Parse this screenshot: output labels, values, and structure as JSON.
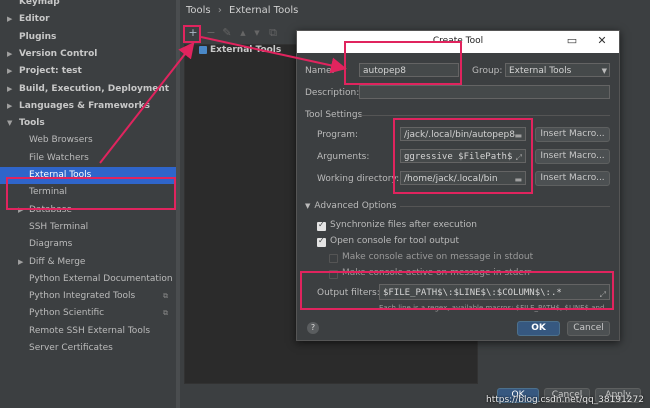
{
  "sidebar": {
    "items": [
      {
        "label": "Keymap",
        "arrow": "",
        "indent": 0,
        "bold": true
      },
      {
        "label": "Editor",
        "arrow": "▶",
        "indent": 0,
        "bold": true
      },
      {
        "label": "Plugins",
        "arrow": "",
        "indent": 0,
        "bold": true
      },
      {
        "label": "Version Control",
        "arrow": "▶",
        "indent": 0,
        "bold": true
      },
      {
        "label": "Project: test",
        "arrow": "▶",
        "indent": 0,
        "bold": true
      },
      {
        "label": "Build, Execution, Deployment",
        "arrow": "▶",
        "indent": 0,
        "bold": true
      },
      {
        "label": "Languages & Frameworks",
        "arrow": "▶",
        "indent": 0,
        "bold": true
      },
      {
        "label": "Tools",
        "arrow": "▼",
        "indent": 0,
        "bold": true
      },
      {
        "label": "Web Browsers",
        "arrow": "",
        "indent": 1,
        "bold": false
      },
      {
        "label": "File Watchers",
        "arrow": "",
        "indent": 1,
        "bold": false
      },
      {
        "label": "External Tools",
        "arrow": "",
        "indent": 1,
        "bold": false,
        "selected": true
      },
      {
        "label": "Terminal",
        "arrow": "",
        "indent": 1,
        "bold": false
      },
      {
        "label": "Database",
        "arrow": "▶",
        "indent": 1,
        "bold": false
      },
      {
        "label": "SSH Terminal",
        "arrow": "",
        "indent": 1,
        "bold": false
      },
      {
        "label": "Diagrams",
        "arrow": "",
        "indent": 1,
        "bold": false
      },
      {
        "label": "Diff & Merge",
        "arrow": "▶",
        "indent": 1,
        "bold": false
      },
      {
        "label": "Python External Documentation",
        "arrow": "",
        "indent": 1,
        "bold": false
      },
      {
        "label": "Python Integrated Tools",
        "arrow": "",
        "indent": 1,
        "bold": false,
        "badge": "⧉"
      },
      {
        "label": "Python Scientific",
        "arrow": "",
        "indent": 1,
        "bold": false,
        "badge": "⧉"
      },
      {
        "label": "Remote SSH External Tools",
        "arrow": "",
        "indent": 1,
        "bold": false
      },
      {
        "label": "Server Certificates",
        "arrow": "",
        "indent": 1,
        "bold": false
      }
    ]
  },
  "breadcrumb": {
    "part1": "Tools",
    "sep": "›",
    "part2": "External Tools"
  },
  "toolbar": {
    "add": "+",
    "remove": "−",
    "edit": "✎",
    "up": "▲",
    "down": "▼",
    "copy": "⧉"
  },
  "tree": {
    "group_label": "External Tools"
  },
  "dialog": {
    "title": "Create Tool",
    "name_label": "Name:",
    "name_value": "autopep8",
    "group_label": "Group:",
    "group_value": "External Tools",
    "description_label": "Description:",
    "description_value": "",
    "tool_settings": "Tool Settings",
    "program_label": "Program:",
    "program_value": "/jack/.local/bin/autopep8",
    "arguments_label": "Arguments:",
    "arguments_value": "ggressive $FilePath$",
    "workdir_label": "Working directory:",
    "workdir_value": "/home/jack/.local/bin",
    "insert_macro": "Insert Macro...",
    "advanced": "Advanced Options",
    "sync_label": "Synchronize files after execution",
    "console_label": "Open console for tool output",
    "stdout_label": "Make console active on message in stdout",
    "stderr_label": "Make console active on message in stderr",
    "output_filters_label": "Output filters:",
    "output_filters_value": "$FILE_PATH$\\:$LINE$\\:$COLUMN$\\:.*",
    "hint": "Each line is a regex, available macros: $FILE_PATH$, $LINE$ and",
    "ok": "OK",
    "cancel": "Cancel",
    "help": "?"
  },
  "footer": {
    "ok": "OK",
    "cancel": "Cancel",
    "apply": "Apply"
  },
  "watermark": "https://blog.csdn.net/qq_38191272"
}
